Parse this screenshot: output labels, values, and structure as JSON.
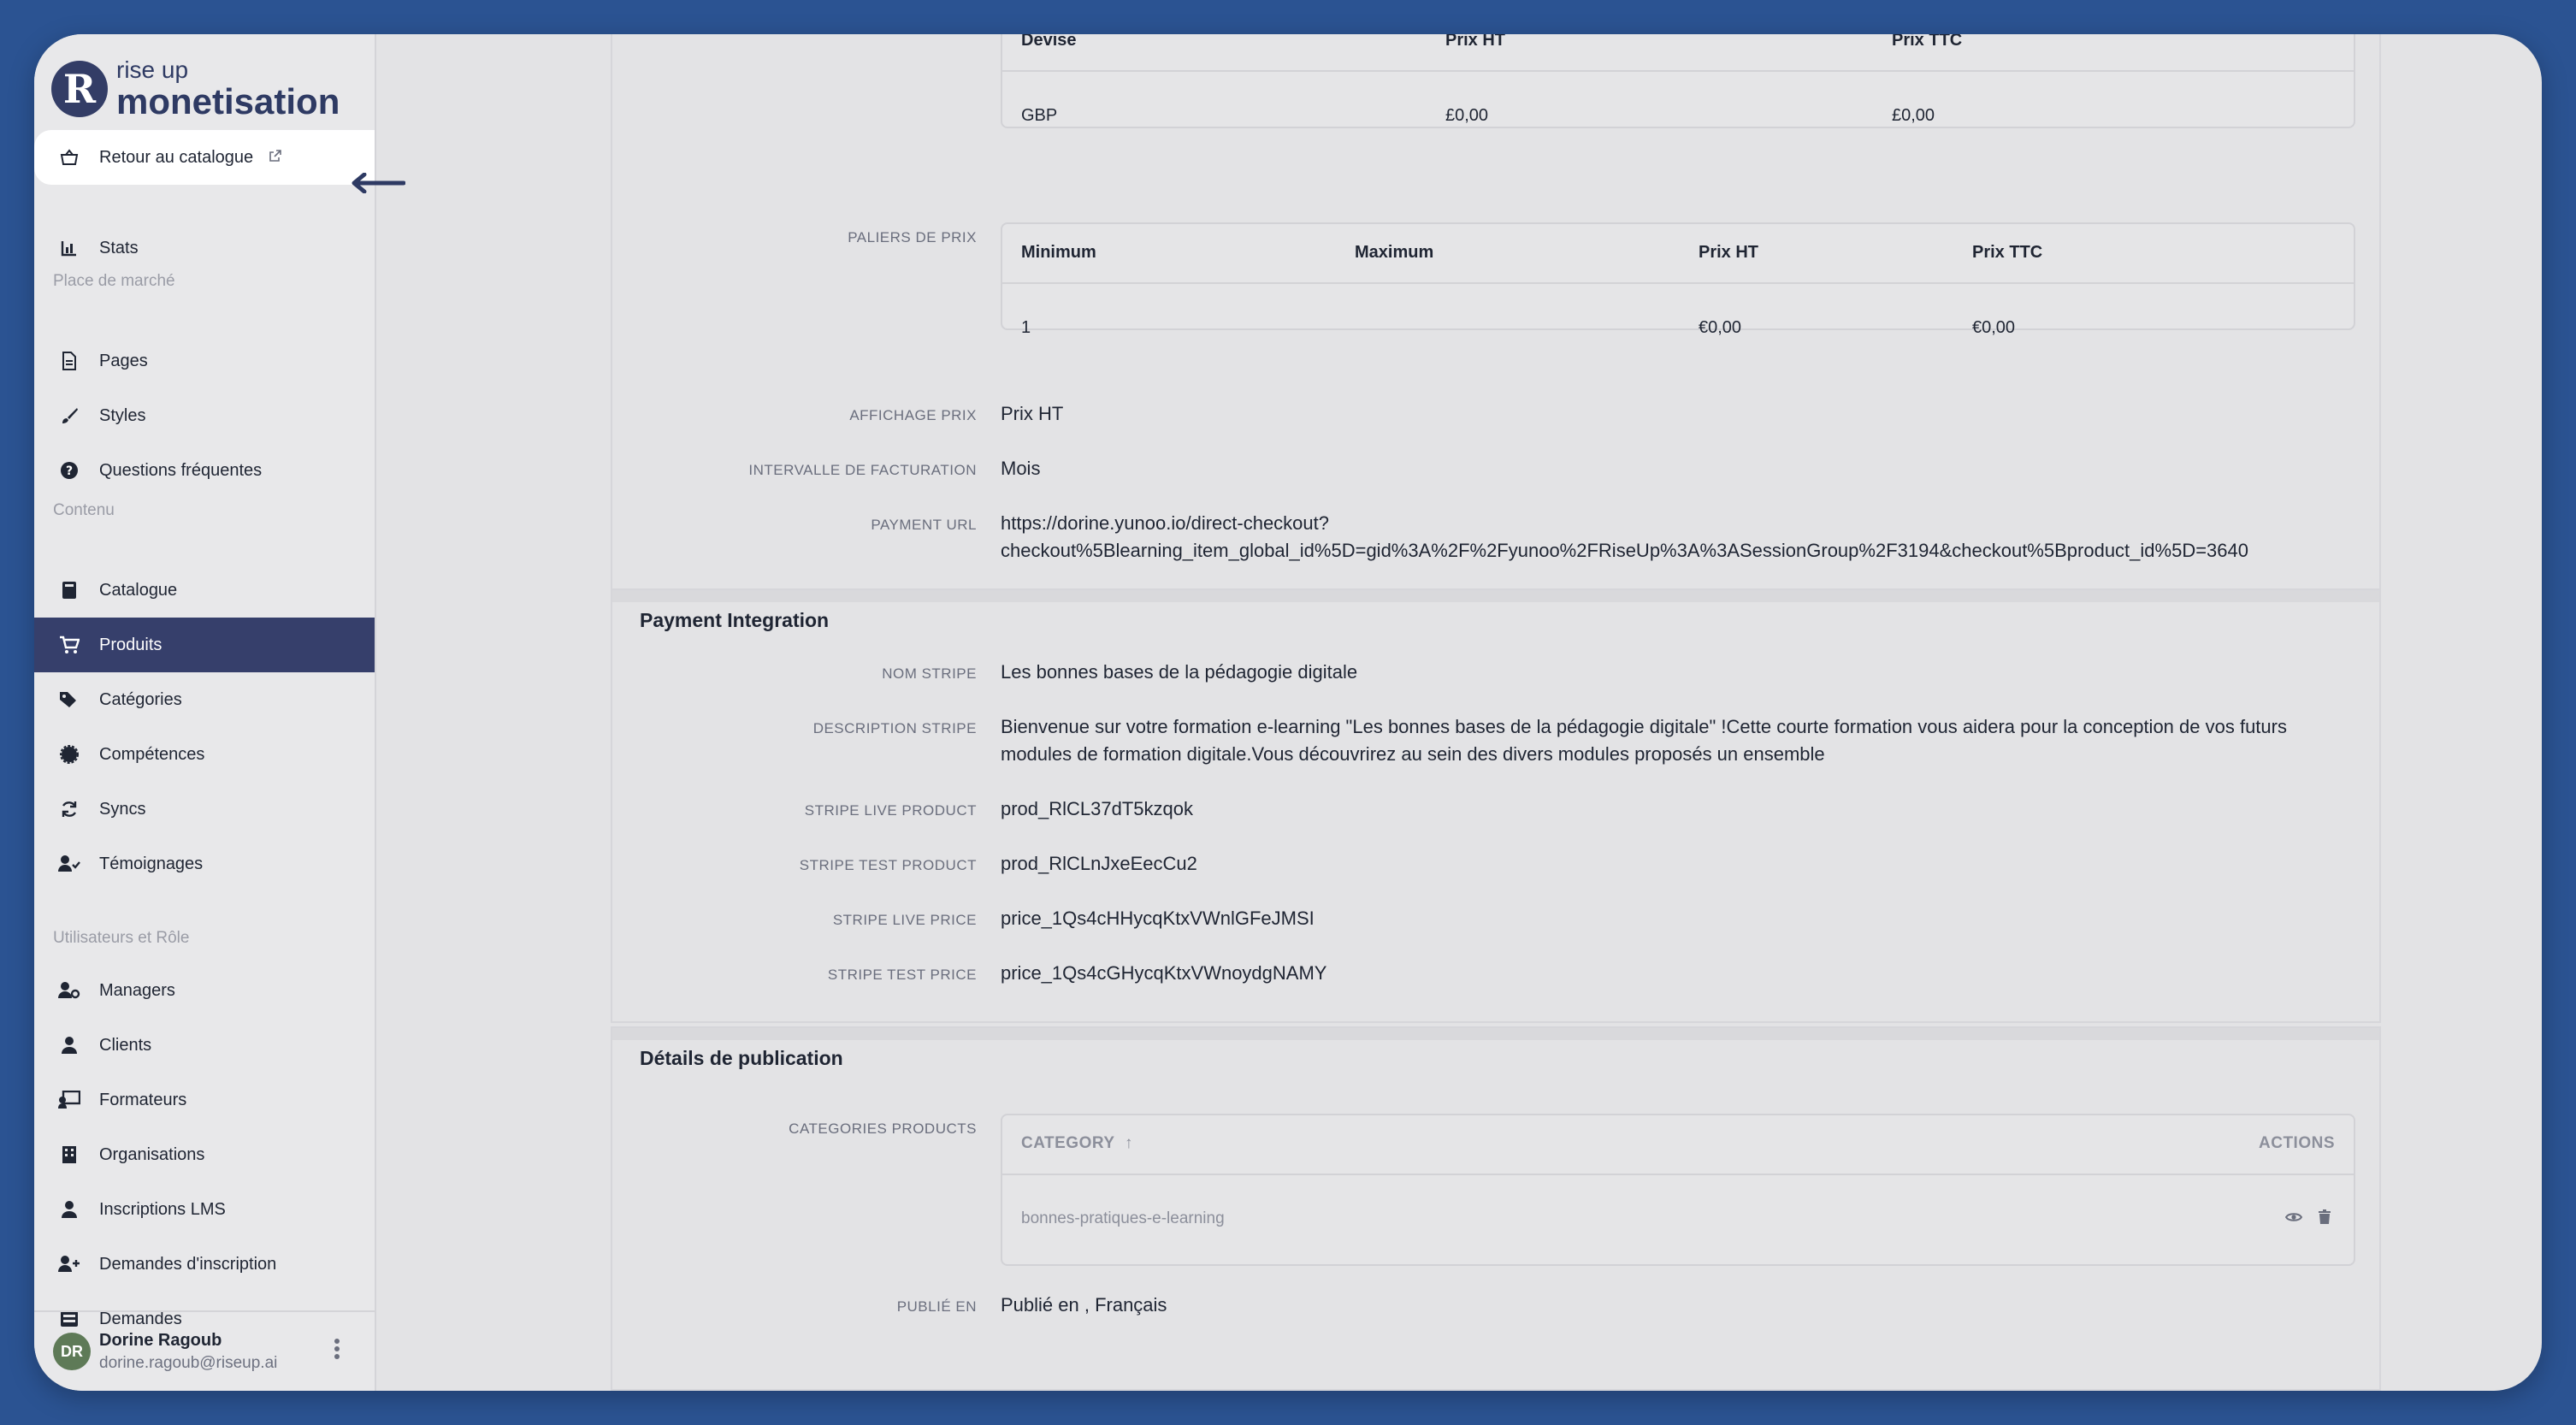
{
  "brand": {
    "mark": "R",
    "top": "rise up",
    "bottom": "monetisation"
  },
  "sidebar": {
    "back_link": "Retour au catalogue",
    "stats": "Stats",
    "section_marketplace": "Place de marché",
    "pages": "Pages",
    "styles": "Styles",
    "faq": "Questions fréquentes",
    "section_content": "Contenu",
    "catalogue": "Catalogue",
    "products": "Produits",
    "categories": "Catégories",
    "skills": "Compétences",
    "syncs": "Syncs",
    "testimonials": "Témoignages",
    "section_users": "Utilisateurs et Rôle",
    "managers": "Managers",
    "clients": "Clients",
    "trainers": "Formateurs",
    "organisations": "Organisations",
    "lms": "Inscriptions LMS",
    "requests_signup": "Demandes d'inscription",
    "requests": "Demandes"
  },
  "user": {
    "initials": "DR",
    "name": "Dorine Ragoub",
    "email": "dorine.ragoub@riseup.ai"
  },
  "currency_table": {
    "headers": [
      "Devise",
      "Prix HT",
      "Prix TTC"
    ],
    "row": [
      "GBP",
      "£0,00",
      "£0,00"
    ]
  },
  "tiers": {
    "label": "PALIERS DE PRIX",
    "headers": [
      "Minimum",
      "Maximum",
      "Prix HT",
      "Prix TTC"
    ],
    "row": [
      "1",
      "",
      "€0,00",
      "€0,00"
    ]
  },
  "price_display": {
    "label": "AFFICHAGE PRIX",
    "value": "Prix HT"
  },
  "billing_interval": {
    "label": "INTERVALLE DE FACTURATION",
    "value": "Mois"
  },
  "payment_url": {
    "label": "PAYMENT URL",
    "line1": "https://dorine.yunoo.io/direct-checkout?",
    "line2": "checkout%5Blearning_item_global_id%5D=gid%3A%2F%2Fyunoo%2FRiseUp%3A%3ASessionGroup%2F3194&checkout%5Bproduct_id%5D=3640"
  },
  "payment_integration": {
    "title": "Payment Integration",
    "stripe_name_label": "NOM STRIPE",
    "stripe_name": "Les bonnes bases de la pédagogie digitale",
    "stripe_desc_label": "DESCRIPTION STRIPE",
    "stripe_desc_line1": "Bienvenue sur votre formation e-learning \"Les bonnes bases de la pédagogie digitale\" !Cette courte formation vous aidera pour la conception de vos futurs",
    "stripe_desc_line2": "modules de formation digitale.Vous découvrirez au sein des divers modules proposés un ensemble",
    "live_product_label": "STRIPE LIVE PRODUCT",
    "live_product": "prod_RlCL37dT5kzqok",
    "test_product_label": "STRIPE TEST PRODUCT",
    "test_product": "prod_RlCLnJxeEecCu2",
    "live_price_label": "STRIPE LIVE PRICE",
    "live_price": "price_1Qs4cHHycqKtxVWnlGFeJMSI",
    "test_price_label": "STRIPE TEST PRICE",
    "test_price": "price_1Qs4cGHycqKtxVWnoydgNAMY"
  },
  "publication": {
    "title": "Détails de publication",
    "categories_label": "CATEGORIES PRODUCTS",
    "col_category": "CATEGORY",
    "col_actions": "ACTIONS",
    "category_row": "bonnes-pratiques-e-learning",
    "published_label": "PUBLIÉ EN",
    "published_value": "Publié en , Français"
  },
  "colors": {
    "accent": "#363f6b",
    "background": "#2b5392"
  }
}
